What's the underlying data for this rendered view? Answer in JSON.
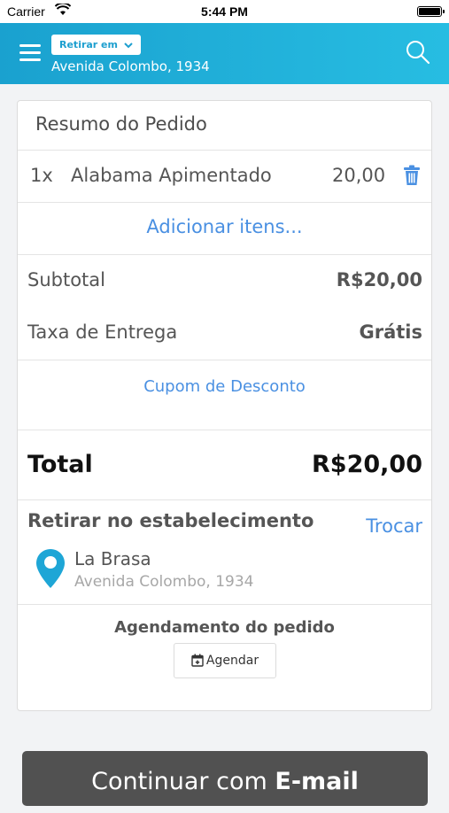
{
  "status_bar": {
    "carrier": "Carrier",
    "time": "5:44 PM"
  },
  "header": {
    "mode_button": "Retirar em",
    "address": "Avenida Colombo, 1934",
    "brand_color": "#1ea6d6"
  },
  "order_summary": {
    "title": "Resumo do Pedido",
    "items": [
      {
        "qty": "1x",
        "name": "Alabama Apimentado",
        "price": "20,00"
      }
    ],
    "add_items": "Adicionar itens...",
    "subtotal_label": "Subtotal",
    "subtotal_value": "R$20,00",
    "delivery_label": "Taxa de Entrega",
    "delivery_value": "Grátis",
    "coupon": "Cupom de Desconto",
    "total_label": "Total",
    "total_value": "R$20,00"
  },
  "pickup": {
    "title": "Retirar no estabelecimento",
    "change": "Trocar",
    "store_name": "La Brasa",
    "store_address": "Avenida Colombo, 1934"
  },
  "schedule": {
    "title": "Agendamento do pedido",
    "button": "Agendar"
  },
  "continue_button": {
    "prefix": "Continuar com",
    "emphasis": "E-mail"
  },
  "accent_color": "#4a90e2"
}
